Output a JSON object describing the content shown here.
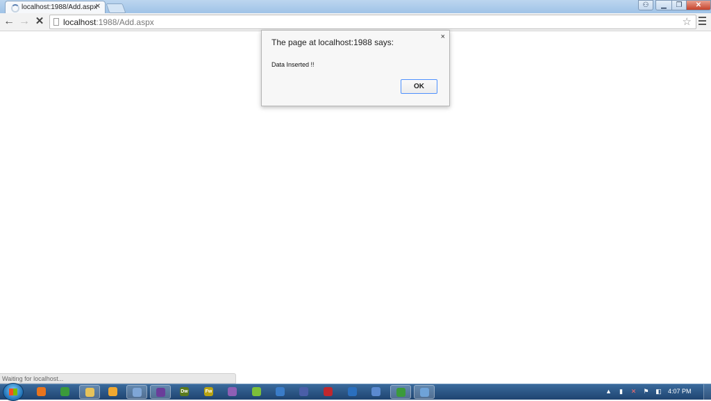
{
  "browser": {
    "tab": {
      "title": "localhost:1988/Add.aspx",
      "close_glyph": "✕"
    },
    "address": {
      "host": "localhost",
      "path": ":1988/Add.aspx"
    },
    "nav": {
      "back_glyph": "←",
      "forward_glyph": "→",
      "stop_glyph": "✕",
      "star_glyph": "☆"
    },
    "window_controls": {
      "minimize": "▁",
      "maximize": "❐",
      "close": "✕"
    }
  },
  "dialog": {
    "heading": "The page at localhost:1988 says:",
    "message": "Data Inserted !!",
    "ok_label": "OK",
    "close_glyph": "×"
  },
  "status": {
    "text": "Waiting for localhost..."
  },
  "taskbar": {
    "clock": "4:07 PM",
    "items": [
      {
        "name": "firefox-icon",
        "color": "#e8741e",
        "label": ""
      },
      {
        "name": "chrome-icon",
        "color": "#3b9a3b",
        "label": ""
      },
      {
        "name": "explorer-icon",
        "color": "#e6c25a",
        "label": ""
      },
      {
        "name": "media-player-icon",
        "color": "#f0a830",
        "label": ""
      },
      {
        "name": "paint-icon",
        "color": "#7fa6d6",
        "label": ""
      },
      {
        "name": "visual-studio-icon",
        "color": "#6a3d9a",
        "label": ""
      },
      {
        "name": "dreamweaver-icon",
        "color": "#5a7a1e",
        "label": "Dw"
      },
      {
        "name": "fireworks-icon",
        "color": "#b8a312",
        "label": "Fw"
      },
      {
        "name": "browser-icon",
        "color": "#8e5fb5",
        "label": ""
      },
      {
        "name": "android-icon",
        "color": "#7cbf3a",
        "label": ""
      },
      {
        "name": "globe-icon",
        "color": "#3a7cc8",
        "label": ""
      },
      {
        "name": "link-icon",
        "color": "#4a5ea8",
        "label": ""
      },
      {
        "name": "filezilla-icon",
        "color": "#c0272d",
        "label": ""
      },
      {
        "name": "outlook-icon",
        "color": "#2a6fbe",
        "label": ""
      },
      {
        "name": "tool-icon",
        "color": "#5b8ad0",
        "label": ""
      },
      {
        "name": "chrome-active-icon",
        "color": "#3b9a3b",
        "label": ""
      },
      {
        "name": "app-icon",
        "color": "#6fa3d8",
        "label": ""
      }
    ]
  }
}
